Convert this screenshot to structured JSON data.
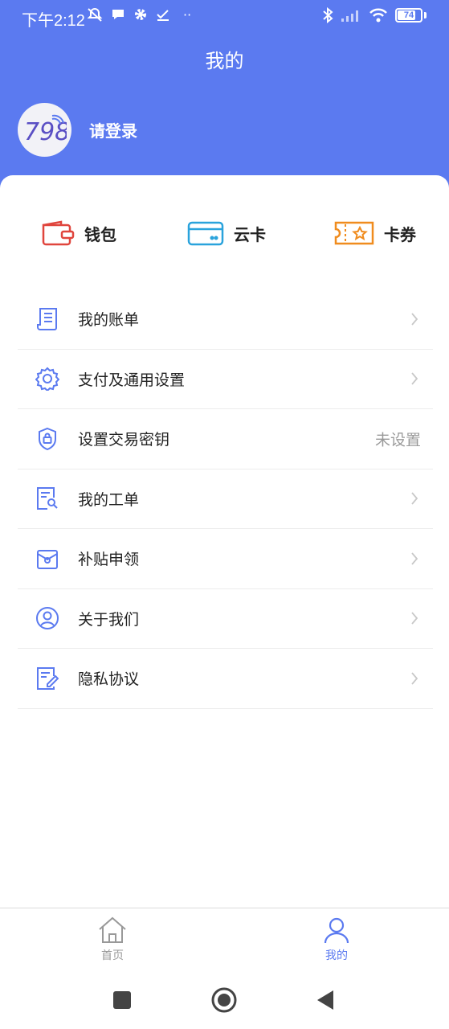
{
  "status_bar": {
    "time": "下午2:12",
    "battery": "74"
  },
  "header": {
    "title": "我的",
    "login_prompt": "请登录",
    "logo_text": "798"
  },
  "quick_actions": [
    {
      "label": "钱包",
      "icon": "wallet-icon",
      "color": "#e0453d"
    },
    {
      "label": "云卡",
      "icon": "card-icon",
      "color": "#2aa3dc"
    },
    {
      "label": "卡券",
      "icon": "coupon-icon",
      "color": "#f08c1e"
    }
  ],
  "menu": [
    {
      "label": "我的账单",
      "icon": "bill-icon",
      "value": ""
    },
    {
      "label": "支付及通用设置",
      "icon": "gear-icon",
      "value": ""
    },
    {
      "label": "设置交易密钥",
      "icon": "shield-lock-icon",
      "value": "未设置"
    },
    {
      "label": "我的工单",
      "icon": "work-order-icon",
      "value": ""
    },
    {
      "label": "补贴申领",
      "icon": "subsidy-icon",
      "value": ""
    },
    {
      "label": "关于我们",
      "icon": "user-circle-icon",
      "value": ""
    },
    {
      "label": "隐私协议",
      "icon": "privacy-doc-icon",
      "value": ""
    }
  ],
  "tabbar": {
    "home_label": "首页",
    "mine_label": "我的",
    "active_color": "#5b7af0",
    "inactive_color": "#999999"
  },
  "colors": {
    "header_bg": "#5b7af0",
    "icon_blue": "#5b7af0"
  }
}
